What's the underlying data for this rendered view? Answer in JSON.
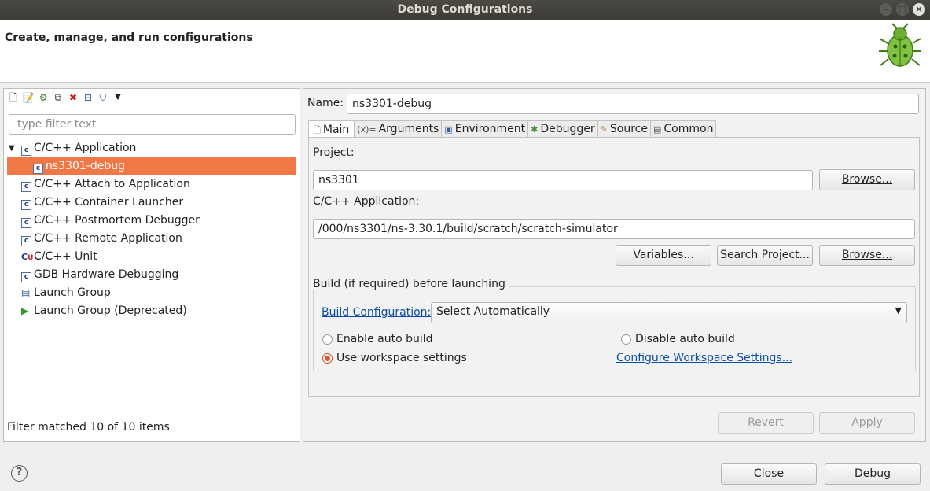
{
  "window": {
    "title": "Debug Configurations"
  },
  "banner": {
    "title": "Create, manage, and run configurations"
  },
  "left": {
    "filter_placeholder": "type filter text",
    "tree": [
      {
        "label": "C/C++ Application",
        "expanded": true,
        "icon": "c-app-icon"
      },
      {
        "label": "ns3301-debug",
        "child": true,
        "selected": true,
        "icon": "c-app-icon"
      },
      {
        "label": "C/C++ Attach to Application",
        "icon": "c-app-icon"
      },
      {
        "label": "C/C++ Container Launcher",
        "icon": "c-app-icon"
      },
      {
        "label": "C/C++ Postmortem Debugger",
        "icon": "c-app-icon"
      },
      {
        "label": "C/C++ Remote Application",
        "icon": "c-app-icon"
      },
      {
        "label": "C/C++ Unit",
        "icon": "c-unit-icon"
      },
      {
        "label": "GDB Hardware Debugging",
        "icon": "c-app-icon"
      },
      {
        "label": "Launch Group",
        "icon": "launch-group-icon"
      },
      {
        "label": "Launch Group (Deprecated)",
        "icon": "play-icon"
      }
    ],
    "status": "Filter matched 10 of 10 items"
  },
  "right": {
    "name_label": "Name:",
    "name_value": "ns3301-debug",
    "tabs": [
      {
        "label": "Main",
        "active": true
      },
      {
        "label": "Arguments"
      },
      {
        "label": "Environment"
      },
      {
        "label": "Debugger"
      },
      {
        "label": "Source"
      },
      {
        "label": "Common"
      }
    ],
    "project_label": "Project:",
    "project_value": "ns3301",
    "browse_label": "Browse...",
    "app_label": "C/C++ Application:",
    "app_value": "/000/ns3301/ns-3.30.1/build/scratch/scratch-simulator",
    "variables_label": "Variables...",
    "search_project_label": "Search Project...",
    "build_group_title": "Build (if required) before launching",
    "build_config_link": "Build Configuration:",
    "build_config_value": "Select Automatically",
    "enable_auto_build": "Enable auto build",
    "disable_auto_build": "Disable auto build",
    "use_workspace": "Use workspace settings",
    "configure_workspace": "Configure Workspace Settings...",
    "revert_label": "Revert",
    "apply_label": "Apply"
  },
  "footer": {
    "close_label": "Close",
    "debug_label": "Debug"
  }
}
